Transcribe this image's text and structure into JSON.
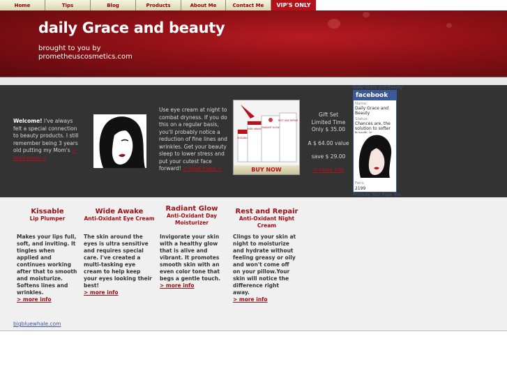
{
  "nav": {
    "items": [
      "Home",
      "Tips",
      "Blog",
      "Products",
      "About Me",
      "Contact Me"
    ],
    "vip": "VIP'S ONLY"
  },
  "header": {
    "title": "daily Grace and beauty",
    "subtitle": "brought to you by prometheuscosmetics.com"
  },
  "welcome": {
    "bold": "Welcome!",
    "text": " I've always felt a special connection to beauty products. I still remember being 3 years old putting my Mom's ",
    "link": "> read more <"
  },
  "eye_cream": {
    "text": "Use eye cream at night to combat dryness. If you do this on a regular basis, you'll probably notice a reduction of fine lines and wrinkles. Get your beauty sleep to lower stress and put your cutest face forward! ",
    "link": "> read more <"
  },
  "product_box": {
    "buy_label": "BUY NOW",
    "labels": [
      "KISSABLE",
      "WIDE AWAKE",
      "RADIANT GLOW",
      "REST AND REPAIR"
    ]
  },
  "gift": {
    "line1": "Gift Set",
    "line2": "Limited Time",
    "line3": "Only $ 35.00",
    "value": "A $ 64.00 value",
    "save": "save $ 29.00",
    "link": "> more info"
  },
  "facebook": {
    "top_link": "Daily Grace and Beauty",
    "brand": "facebook",
    "name_label": "Name:",
    "name": "Daily Grace and Beauty",
    "status_label": "Status:",
    "status": "Chances are, the solution to softer hands is...",
    "fans_label": "Fans:",
    "fans": "2199",
    "bottom_link": "Promote Your Page Too"
  },
  "products": [
    {
      "name": "Kissable",
      "sub": "Lip Plumper",
      "desc": "Makes your lips full, soft, and inviting. It tingles when applied and continues working after that to smooth and moisturize. Softens lines and wrinkles.",
      "link": "> more info"
    },
    {
      "name": "Wide Awake",
      "sub": "Anti-Oxidant Eye Cream",
      "desc": "The skin around the eyes is ultra sensitive and requires special care. I've created a multi-tasking eye cream to help keep your eyes looking their best!",
      "link": "> more info"
    },
    {
      "name": "Radiant Glow",
      "sub": "Anti-Oxidant Day Moisturizer",
      "desc": "Invigorate your skin with a healthy glow that is alive and vibrant. It promotes smooth skin with an even color tone that begs a gentle touch.",
      "link": "> more info"
    },
    {
      "name": "Rest and Repair",
      "sub": "Anti-Oxidant Night Cream",
      "desc": "Clings to your skin at night to moisturize and hydrate without feeling greasy or oily and won't come off on your pillow.Your skin will notice the difference right away.",
      "link": "> more info"
    }
  ],
  "footer": {
    "link": "bigbluewhale.com"
  },
  "colors": {
    "brand_red": "#9b0d14",
    "dark_band": "#333333",
    "facebook_blue": "#3b5998"
  }
}
